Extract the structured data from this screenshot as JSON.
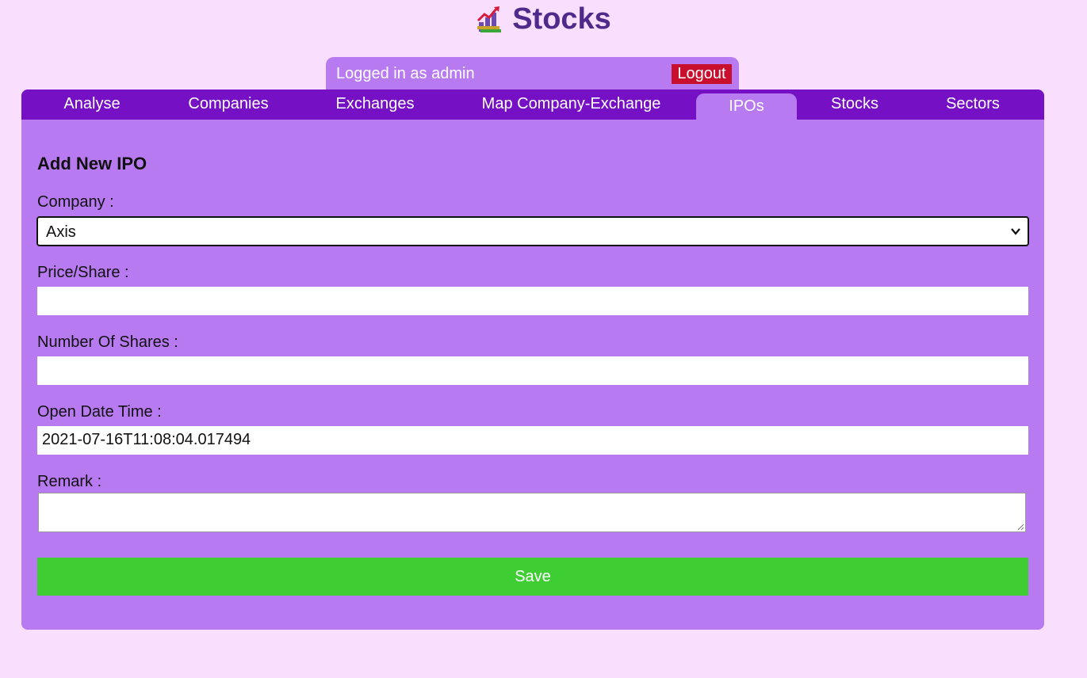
{
  "header": {
    "title": "Stocks",
    "logo_icon": "stock-chart-icon"
  },
  "session": {
    "logged_in_text": "Logged in as admin",
    "logout_label": "Logout"
  },
  "nav": {
    "tabs": [
      {
        "label": "Analyse",
        "active": false
      },
      {
        "label": "Companies",
        "active": false
      },
      {
        "label": "Exchanges",
        "active": false
      },
      {
        "label": "Map Company-Exchange",
        "active": false
      },
      {
        "label": "IPOs",
        "active": true
      },
      {
        "label": "Stocks",
        "active": false
      },
      {
        "label": "Sectors",
        "active": false
      }
    ]
  },
  "form": {
    "heading": "Add New IPO",
    "company_label": "Company :",
    "company_value": "Axis",
    "price_label": "Price/Share :",
    "price_value": "",
    "shares_label": "Number Of Shares :",
    "shares_value": "",
    "open_date_label": "Open Date Time :",
    "open_date_value": "2021-07-16T11:08:04.017494",
    "remark_label": "Remark :",
    "remark_value": "",
    "save_label": "Save"
  },
  "colors": {
    "page_background": "#f9dffd",
    "panel": "#b77af1",
    "tabbar": "#7610c4",
    "title": "#4f2a8a",
    "logout": "#c8102e",
    "save": "#3ecd33"
  }
}
